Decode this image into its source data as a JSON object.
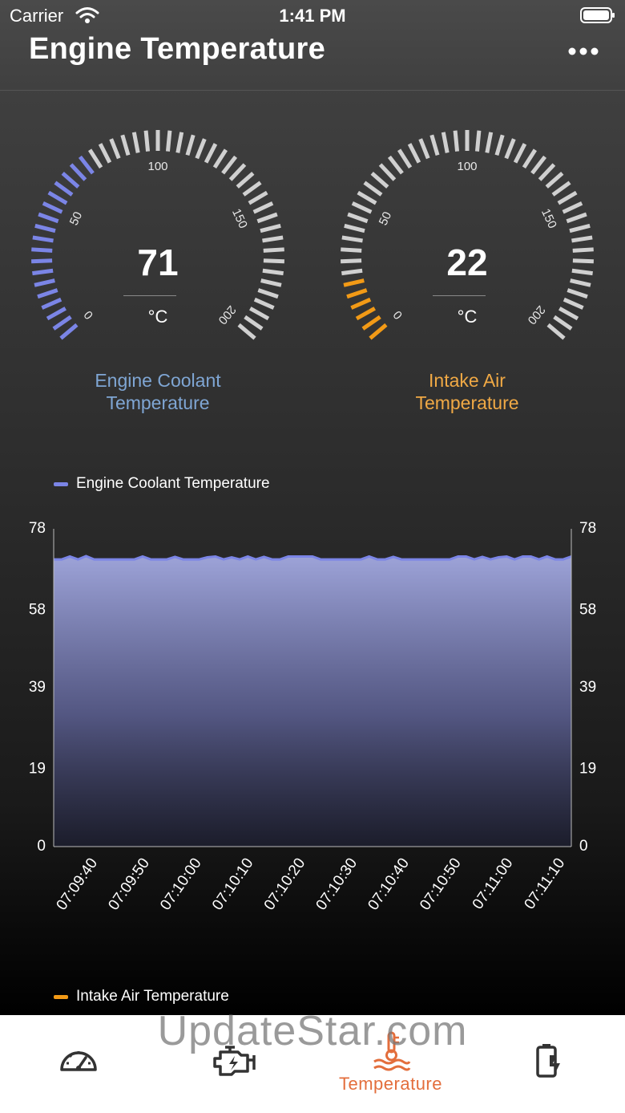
{
  "status_bar": {
    "carrier": "Carrier",
    "time": "1:41 PM"
  },
  "header": {
    "title": "Engine Temperature",
    "more_icon": "more-horizontal-icon"
  },
  "gauges": [
    {
      "value": "71",
      "unit": "°C",
      "label_line1": "Engine Coolant",
      "label_line2": "Temperature",
      "ticks": [
        "0",
        "50",
        "100",
        "150",
        "200"
      ],
      "min": 0,
      "max": 200,
      "reading": 71,
      "color": "#7b85e6",
      "label_color": "#7fa6d4"
    },
    {
      "value": "22",
      "unit": "°C",
      "label_line1": "Intake Air",
      "label_line2": "Temperature",
      "ticks": [
        "0",
        "50",
        "100",
        "150",
        "200"
      ],
      "min": 0,
      "max": 200,
      "reading": 22,
      "color": "#f29a16",
      "label_color": "#f0a945"
    }
  ],
  "legends": {
    "coolant": {
      "label": "Engine Coolant Temperature",
      "color": "#7b85e6"
    },
    "intake": {
      "label": "Intake Air Temperature",
      "color": "#f29a16"
    }
  },
  "chart_data": {
    "type": "area",
    "series": [
      {
        "name": "Engine Coolant Temperature",
        "color": "#7b85e6",
        "values": [
          70.5,
          70.5,
          71.2,
          70.5,
          71.3,
          70.5,
          70.5,
          70.5,
          70.5,
          70.5,
          70.5,
          71.2,
          70.5,
          70.5,
          70.5,
          71.1,
          70.5,
          70.5,
          70.5,
          71.0,
          71.2,
          70.5,
          71.0,
          70.5,
          71.2,
          70.5,
          71.1,
          70.5,
          70.5,
          71.2,
          71.2,
          71.2,
          71.2,
          70.5,
          70.5,
          70.5,
          70.5,
          70.5,
          70.5,
          71.2,
          70.5,
          70.5,
          71.1,
          70.5,
          70.5,
          70.5,
          70.5,
          70.5,
          70.5,
          70.5,
          71.2,
          71.2,
          70.5,
          71.1,
          70.5,
          71.0,
          71.2,
          70.5,
          71.2,
          71.2,
          70.5,
          71.2,
          70.5,
          70.5,
          71.2
        ]
      }
    ],
    "y_ticks": [
      "0",
      "19",
      "39",
      "58",
      "78"
    ],
    "ylim": [
      0,
      78
    ],
    "x_ticks": [
      "07:09:40",
      "07:09:50",
      "07:10:00",
      "07:10:10",
      "07:10:20",
      "07:10:30",
      "07:10:40",
      "07:10:50",
      "07:11:00",
      "07:11:10"
    ],
    "legend": "top-left",
    "grid": false
  },
  "tab_bar": {
    "tabs": [
      {
        "icon": "speedometer-icon",
        "label": ""
      },
      {
        "icon": "engine-icon",
        "label": ""
      },
      {
        "icon": "coolant-temperature-icon",
        "label": "Temperature"
      },
      {
        "icon": "battery-charge-icon",
        "label": ""
      }
    ],
    "active_color": "#e36e3c"
  },
  "watermark": "UpdateStar.com"
}
